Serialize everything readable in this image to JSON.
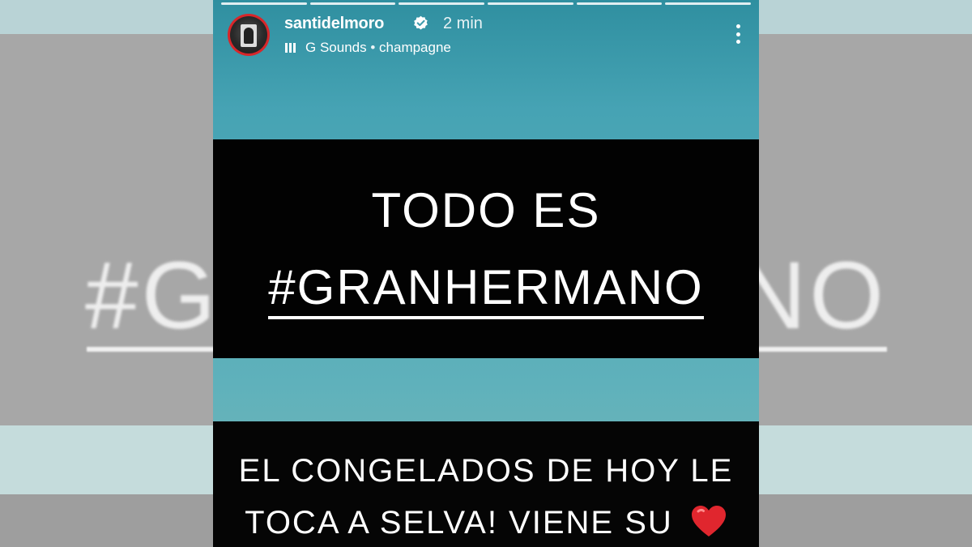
{
  "background": {
    "hashtag_left": "#G",
    "hashtag_right": "NO"
  },
  "story": {
    "progress_segments": 6,
    "header": {
      "username": "santidelmoro",
      "verified_icon": "verified-badge-icon",
      "time": "2 min",
      "music_icon": "music-bars-icon",
      "artist": "G Sounds",
      "separator": "•",
      "song": "champagne",
      "more_icon": "more-vertical-icon"
    },
    "headline": {
      "line1": "TODO ES",
      "line2": "#GRANHERMANO"
    },
    "caption": {
      "line1": "EL CONGELADOS DE HOY LE",
      "line2": "TOCA A SELVA! VIENE SU",
      "emoji": "red-heart-icon"
    }
  },
  "colors": {
    "accent_red": "#d8262a",
    "story_teal": "#46a3b4",
    "text_box": "#020202"
  }
}
